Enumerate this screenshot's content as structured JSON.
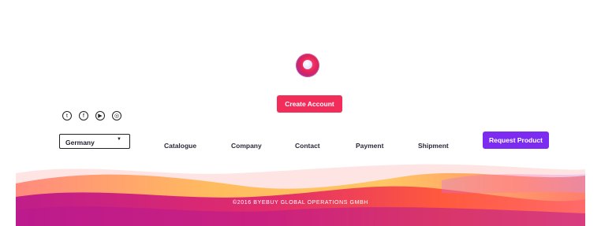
{
  "header": {
    "create_account_label": "Create Account"
  },
  "socials": [
    {
      "icon": "twitter-icon",
      "glyph": "t"
    },
    {
      "icon": "facebook-icon",
      "glyph": "f"
    },
    {
      "icon": "youtube-icon",
      "glyph": "▶"
    },
    {
      "icon": "instagram-icon",
      "glyph": "◎"
    }
  ],
  "footer": {
    "country_select_value": "Germany",
    "nav": [
      "Catalogue",
      "Company",
      "Contact",
      "Payment",
      "Shipment"
    ],
    "request_product_label": "Request Product",
    "copyright": "©2016 BYEBUY GLOBAL OPERATIONS GMBH"
  },
  "colors": {
    "create_button": "#f22d5a",
    "request_button": "#7c2cf0",
    "wave_orange": "#ffb347",
    "wave_pink": "#ff3f7f",
    "wave_purple": "#a43be6"
  }
}
